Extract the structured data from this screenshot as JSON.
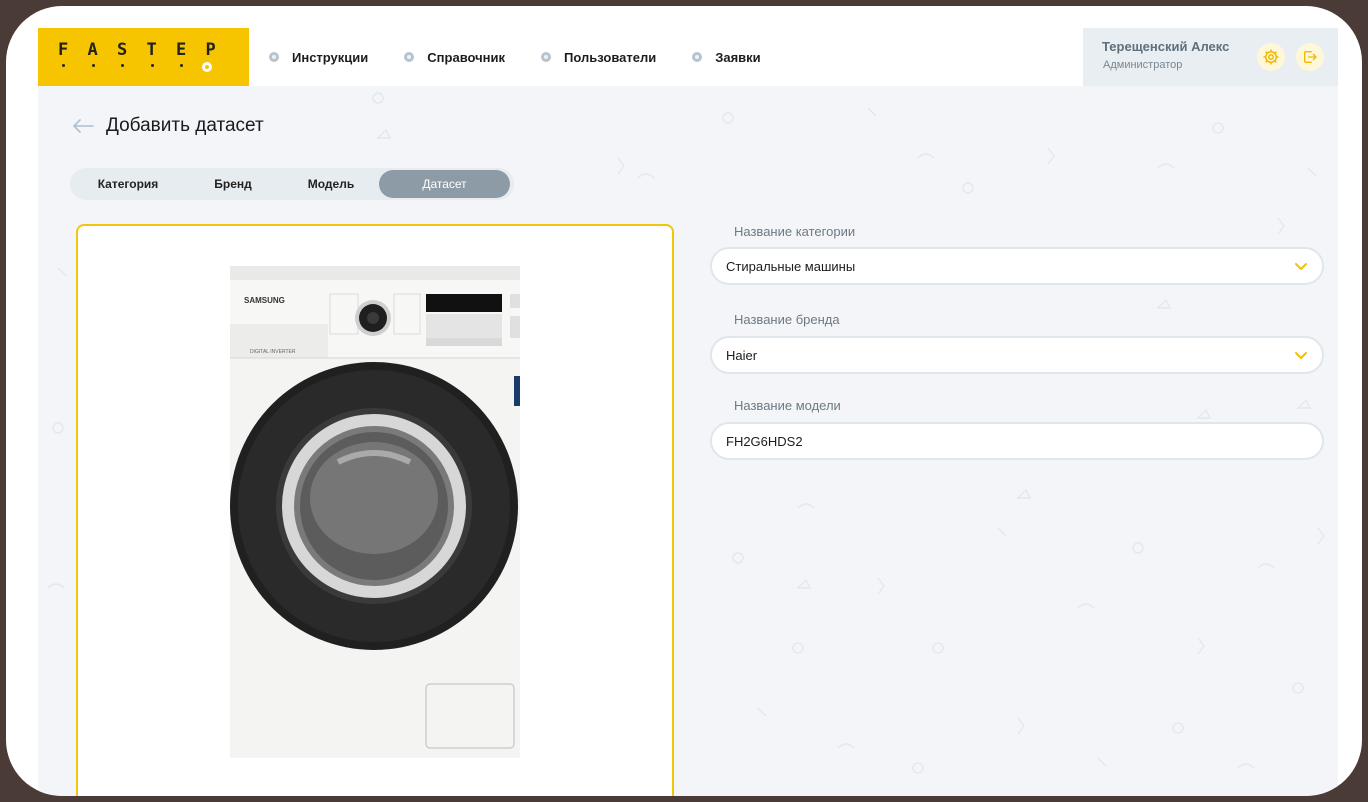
{
  "brand": {
    "logo_letters": [
      "F",
      "A",
      "S",
      "T",
      "E",
      "P"
    ],
    "accent": "#f7c400"
  },
  "nav": {
    "items": [
      {
        "label": "Инструкции"
      },
      {
        "label": "Справочник"
      },
      {
        "label": "Пользователи"
      },
      {
        "label": "Заявки"
      }
    ]
  },
  "user": {
    "name": "Терещенский Алекс",
    "role": "Администратор",
    "icons": [
      "gear-icon",
      "logout-icon"
    ]
  },
  "page": {
    "title": "Добавить датасет",
    "back_icon": "arrow-left-icon"
  },
  "tabs": {
    "items": [
      {
        "label": "Категория"
      },
      {
        "label": "Бренд"
      },
      {
        "label": "Модель"
      },
      {
        "label": "Датасет"
      }
    ],
    "active": "Датасет"
  },
  "image": {
    "brand_text": "SAMSUNG",
    "sub_text": "DIGITAL INVERTER"
  },
  "form": {
    "category": {
      "label": "Название категории",
      "value": "Стиральные машины"
    },
    "brand": {
      "label": "Название бренда",
      "value": "Haier"
    },
    "model": {
      "label": "Название модели",
      "value": "FH2G6HDS2"
    }
  }
}
